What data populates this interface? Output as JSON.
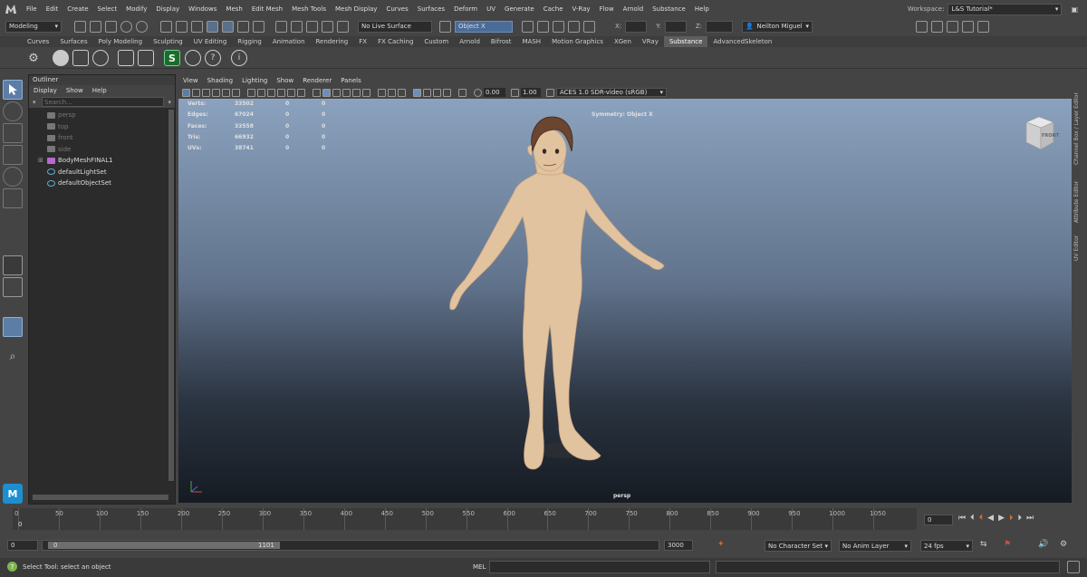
{
  "menubar": {
    "items": [
      "File",
      "Edit",
      "Create",
      "Select",
      "Modify",
      "Display",
      "Windows",
      "Mesh",
      "Edit Mesh",
      "Mesh Tools",
      "Mesh Display",
      "Curves",
      "Surfaces",
      "Deform",
      "UV",
      "Generate",
      "Cache",
      "V-Ray",
      "Flow",
      "Arnold",
      "Substance",
      "Help"
    ],
    "workspace_label": "Workspace:",
    "workspace_value": "L&S Tutorial*"
  },
  "toolbar": {
    "mode": "Modeling",
    "live_surface": "No Live Surface",
    "symmetry": "Object X",
    "x_label": "X:",
    "y_label": "Y:",
    "z_label": "Z:",
    "user": "Neilton Miguel"
  },
  "shelf_tabs": [
    "Curves",
    "Surfaces",
    "Poly Modeling",
    "Sculpting",
    "UV Editing",
    "Rigging",
    "Animation",
    "Rendering",
    "FX",
    "FX Caching",
    "Custom",
    "Arnold",
    "Bifrost",
    "MASH",
    "Motion Graphics",
    "XGen",
    "VRay",
    "Substance",
    "AdvancedSkeleton"
  ],
  "active_shelf": "Substance",
  "outliner": {
    "title": "Outliner",
    "menu": [
      "Display",
      "Show",
      "Help"
    ],
    "search_placeholder": "Search...",
    "items": [
      {
        "label": "persp",
        "type": "camera",
        "dim": true
      },
      {
        "label": "top",
        "type": "camera",
        "dim": true
      },
      {
        "label": "front",
        "type": "camera",
        "dim": true
      },
      {
        "label": "side",
        "type": "camera",
        "dim": true
      },
      {
        "label": "BodyMeshFINAL1",
        "type": "mesh",
        "dim": false
      },
      {
        "label": "defaultLightSet",
        "type": "set",
        "dim": false
      },
      {
        "label": "defaultObjectSet",
        "type": "set",
        "dim": false
      }
    ]
  },
  "viewport": {
    "menu": [
      "View",
      "Shading",
      "Lighting",
      "Show",
      "Renderer",
      "Panels"
    ],
    "exposure": "0.00",
    "gamma": "1.00",
    "color_space": "ACES 1.0 SDR-video (sRGB)",
    "camera_label": "persp",
    "symmetry_label": "Symmetry: Object X",
    "viewcube_label": "FRONT",
    "stats": [
      {
        "label": "Verts:",
        "v1": "33502",
        "v2": "0",
        "v3": "0"
      },
      {
        "label": "Edges:",
        "v1": "67024",
        "v2": "0",
        "v3": "0"
      },
      {
        "label": "Faces:",
        "v1": "33558",
        "v2": "0",
        "v3": "0"
      },
      {
        "label": "Tris:",
        "v1": "66932",
        "v2": "0",
        "v3": "0"
      },
      {
        "label": "UVs:",
        "v1": "38741",
        "v2": "0",
        "v3": "0"
      }
    ]
  },
  "right_tabs": [
    "Channel Box / Layer Editor",
    "Attribute Editor",
    "UV Editor"
  ],
  "timeline": {
    "ticks": [
      "0",
      "50",
      "100",
      "150",
      "200",
      "250",
      "300",
      "350",
      "400",
      "450",
      "500",
      "550",
      "600",
      "650",
      "700",
      "750",
      "800",
      "850",
      "900",
      "950",
      "1000",
      "1050"
    ],
    "start_marker": "0",
    "current_frame": "0"
  },
  "range": {
    "start": "0",
    "inner_start": "0",
    "inner_end": "1101",
    "end": "3000",
    "character_set": "No Character Set",
    "anim_layer": "No Anim Layer",
    "fps": "24 fps"
  },
  "status": {
    "help": "Select Tool: select an object",
    "mel_label": "MEL"
  },
  "colors": {
    "accent": "#4a8bd6",
    "viewport_top": "#8ba2be",
    "viewport_bottom": "#161b23",
    "skin": "#e2c3a0",
    "hair": "#6a4530"
  }
}
